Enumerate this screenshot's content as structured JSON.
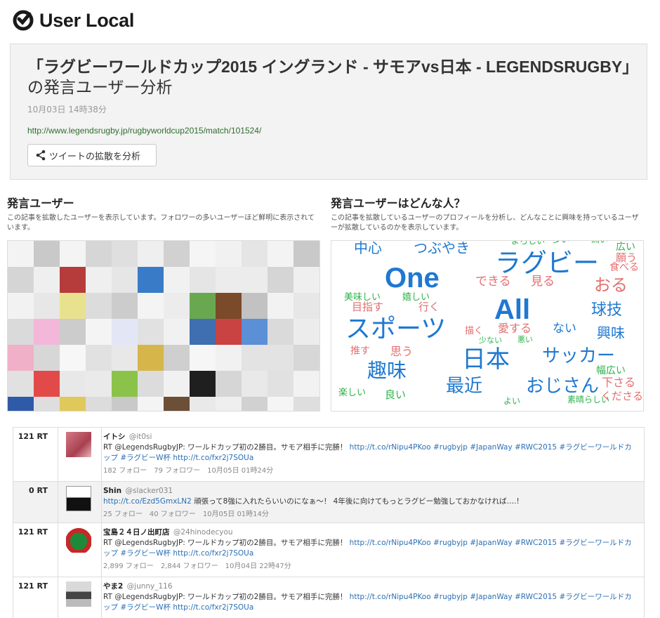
{
  "brand": {
    "name": "User Local"
  },
  "article": {
    "title_main": "「ラグビーワールドカップ2015 イングランド - サモアvs日本 - LEGENDSRUGBY」",
    "title_suffix": "の発言ユーザー分析",
    "date": "10月03日 14時38分",
    "url": "http://www.legendsrugby.jp/rugbyworldcup2015/match/101524/",
    "analyze_button": "ツイートの拡散を分析"
  },
  "users_section": {
    "title": "発言ユーザー",
    "description": "この記事を拡散したユーザーを表示しています。フォロワーの多いユーザーほど鮮明に表示されています。"
  },
  "profile_section": {
    "title": "発言ユーザーはどんな人？",
    "description": "この記事を拡散しているユーザーのプロフィールを分析し、どんなことに興味を持っているユーザーが拡散しているのかを表示しています。"
  },
  "word_cloud": [
    {
      "text": "中心",
      "color": "#1f78d1"
    },
    {
      "text": "つぶやき",
      "color": "#1f78d1"
    },
    {
      "text": "ラグビー",
      "color": "#1f78d1"
    },
    {
      "text": "One",
      "color": "#1f78d1"
    },
    {
      "text": "できる",
      "color": "#e36e6e"
    },
    {
      "text": "見る",
      "color": "#e36e6e"
    },
    {
      "text": "おる",
      "color": "#e36e6e"
    },
    {
      "text": "美味しい",
      "color": "#2db34a"
    },
    {
      "text": "嬉しい",
      "color": "#2db34a"
    },
    {
      "text": "目指す",
      "color": "#e36e6e"
    },
    {
      "text": "行く",
      "color": "#e36e6e"
    },
    {
      "text": "All",
      "color": "#1f78d1"
    },
    {
      "text": "球技",
      "color": "#1f78d1"
    },
    {
      "text": "スポーツ",
      "color": "#1f78d1"
    },
    {
      "text": "描く",
      "color": "#e36e6e"
    },
    {
      "text": "愛する",
      "color": "#e36e6e"
    },
    {
      "text": "少ない",
      "color": "#2db34a"
    },
    {
      "text": "悪い",
      "color": "#2db34a"
    },
    {
      "text": "ない",
      "color": "#1f78d1"
    },
    {
      "text": "興味",
      "color": "#1f78d1"
    },
    {
      "text": "推す",
      "color": "#e36e6e"
    },
    {
      "text": "思う",
      "color": "#e36e6e"
    },
    {
      "text": "日本",
      "color": "#1f78d1"
    },
    {
      "text": "サッカー",
      "color": "#1f78d1"
    },
    {
      "text": "趣味",
      "color": "#1f78d1"
    },
    {
      "text": "幅広い",
      "color": "#2db34a"
    },
    {
      "text": "下さる",
      "color": "#e36e6e"
    },
    {
      "text": "最近",
      "color": "#1f78d1"
    },
    {
      "text": "おじさん",
      "color": "#1f78d1"
    },
    {
      "text": "楽しい",
      "color": "#2db34a"
    },
    {
      "text": "良い",
      "color": "#2db34a"
    },
    {
      "text": "よい",
      "color": "#2db34a"
    },
    {
      "text": "素晴らしい",
      "color": "#2db34a"
    },
    {
      "text": "くださる",
      "color": "#e36e6e"
    },
    {
      "text": "広い",
      "color": "#2db34a"
    },
    {
      "text": "願う",
      "color": "#e36e6e"
    },
    {
      "text": "食べる",
      "color": "#e36e6e"
    },
    {
      "text": "よろしい",
      "color": "#2db34a"
    },
    {
      "text": "多い",
      "color": "#2db34a"
    },
    {
      "text": "高い",
      "color": "#2db34a"
    }
  ],
  "tweets": [
    {
      "rt": "121 RT",
      "name": "イトシ",
      "handle": "@it0si",
      "text_prefix": "RT @LegendsRugbyJP: ワールドカップ初の2勝目。サモア相手に完勝！ ",
      "links": "http://t.co/rNipu4PKoo #rugbyjp #JapanWay #RWC2015 #ラグビーワールドカップ #ラグビーW杯 http://t.co/fxr2j7SOUa",
      "following": "182 フォロー",
      "followers": "79 フォロワー",
      "time": "10月05日 01時24分"
    },
    {
      "rt": "0 RT",
      "name": "Shin",
      "handle": "@slacker031",
      "link_first": "http://t.co/Ezd5GmxLN2",
      "text_after": " 頑張って8強に入れたらいいのになぁ～！ 4年後に向けてもっとラグビー勉強しておかなければ….!",
      "following": "25 フォロー",
      "followers": "40 フォロワー",
      "time": "10月05日 01時14分"
    },
    {
      "rt": "121 RT",
      "name": "宝島２４日ノ出町店",
      "handle": "@24hinodecyou",
      "text_prefix": "RT @LegendsRugbyJP: ワールドカップ初の2勝目。サモア相手に完勝！ ",
      "links": "http://t.co/rNipu4PKoo #rugbyjp #JapanWay #RWC2015 #ラグビーワールドカップ #ラグビーW杯 http://t.co/fxr2j7SOUa",
      "following": "2,899 フォロー",
      "followers": "2,844 フォロワー",
      "time": "10月04日 22時47分"
    },
    {
      "rt": "121 RT",
      "name": "やま2",
      "handle": "@junny_116",
      "text_prefix": "RT @LegendsRugbyJP: ワールドカップ初の2勝目。サモア相手に完勝！ ",
      "links": "http://t.co/rNipu4PKoo #rugbyjp #JapanWay #RWC2015 #ラグビーワールドカップ #ラグビーW杯 http://t.co/fxr2j7SOUa"
    }
  ]
}
